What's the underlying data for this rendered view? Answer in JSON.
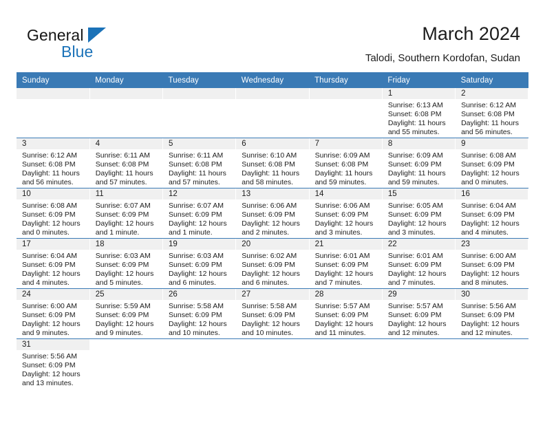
{
  "brand": {
    "name_part1": "General",
    "name_part2": "Blue",
    "color_black": "#151515",
    "color_blue": "#1b72b8"
  },
  "header": {
    "title": "March 2024",
    "location": "Talodi, Southern Kordofan, Sudan",
    "accent_color": "#3a7ab5"
  },
  "weekdays": [
    "Sunday",
    "Monday",
    "Tuesday",
    "Wednesday",
    "Thursday",
    "Friday",
    "Saturday"
  ],
  "weeks": [
    [
      {
        "day": "",
        "empty": true
      },
      {
        "day": "",
        "empty": true
      },
      {
        "day": "",
        "empty": true
      },
      {
        "day": "",
        "empty": true
      },
      {
        "day": "",
        "empty": true
      },
      {
        "day": "1",
        "sunrise": "Sunrise: 6:13 AM",
        "sunset": "Sunset: 6:08 PM",
        "daylight1": "Daylight: 11 hours",
        "daylight2": "and 55 minutes."
      },
      {
        "day": "2",
        "sunrise": "Sunrise: 6:12 AM",
        "sunset": "Sunset: 6:08 PM",
        "daylight1": "Daylight: 11 hours",
        "daylight2": "and 56 minutes."
      }
    ],
    [
      {
        "day": "3",
        "sunrise": "Sunrise: 6:12 AM",
        "sunset": "Sunset: 6:08 PM",
        "daylight1": "Daylight: 11 hours",
        "daylight2": "and 56 minutes."
      },
      {
        "day": "4",
        "sunrise": "Sunrise: 6:11 AM",
        "sunset": "Sunset: 6:08 PM",
        "daylight1": "Daylight: 11 hours",
        "daylight2": "and 57 minutes."
      },
      {
        "day": "5",
        "sunrise": "Sunrise: 6:11 AM",
        "sunset": "Sunset: 6:08 PM",
        "daylight1": "Daylight: 11 hours",
        "daylight2": "and 57 minutes."
      },
      {
        "day": "6",
        "sunrise": "Sunrise: 6:10 AM",
        "sunset": "Sunset: 6:08 PM",
        "daylight1": "Daylight: 11 hours",
        "daylight2": "and 58 minutes."
      },
      {
        "day": "7",
        "sunrise": "Sunrise: 6:09 AM",
        "sunset": "Sunset: 6:08 PM",
        "daylight1": "Daylight: 11 hours",
        "daylight2": "and 59 minutes."
      },
      {
        "day": "8",
        "sunrise": "Sunrise: 6:09 AM",
        "sunset": "Sunset: 6:09 PM",
        "daylight1": "Daylight: 11 hours",
        "daylight2": "and 59 minutes."
      },
      {
        "day": "9",
        "sunrise": "Sunrise: 6:08 AM",
        "sunset": "Sunset: 6:09 PM",
        "daylight1": "Daylight: 12 hours",
        "daylight2": "and 0 minutes."
      }
    ],
    [
      {
        "day": "10",
        "sunrise": "Sunrise: 6:08 AM",
        "sunset": "Sunset: 6:09 PM",
        "daylight1": "Daylight: 12 hours",
        "daylight2": "and 0 minutes."
      },
      {
        "day": "11",
        "sunrise": "Sunrise: 6:07 AM",
        "sunset": "Sunset: 6:09 PM",
        "daylight1": "Daylight: 12 hours",
        "daylight2": "and 1 minute."
      },
      {
        "day": "12",
        "sunrise": "Sunrise: 6:07 AM",
        "sunset": "Sunset: 6:09 PM",
        "daylight1": "Daylight: 12 hours",
        "daylight2": "and 1 minute."
      },
      {
        "day": "13",
        "sunrise": "Sunrise: 6:06 AM",
        "sunset": "Sunset: 6:09 PM",
        "daylight1": "Daylight: 12 hours",
        "daylight2": "and 2 minutes."
      },
      {
        "day": "14",
        "sunrise": "Sunrise: 6:06 AM",
        "sunset": "Sunset: 6:09 PM",
        "daylight1": "Daylight: 12 hours",
        "daylight2": "and 3 minutes."
      },
      {
        "day": "15",
        "sunrise": "Sunrise: 6:05 AM",
        "sunset": "Sunset: 6:09 PM",
        "daylight1": "Daylight: 12 hours",
        "daylight2": "and 3 minutes."
      },
      {
        "day": "16",
        "sunrise": "Sunrise: 6:04 AM",
        "sunset": "Sunset: 6:09 PM",
        "daylight1": "Daylight: 12 hours",
        "daylight2": "and 4 minutes."
      }
    ],
    [
      {
        "day": "17",
        "sunrise": "Sunrise: 6:04 AM",
        "sunset": "Sunset: 6:09 PM",
        "daylight1": "Daylight: 12 hours",
        "daylight2": "and 4 minutes."
      },
      {
        "day": "18",
        "sunrise": "Sunrise: 6:03 AM",
        "sunset": "Sunset: 6:09 PM",
        "daylight1": "Daylight: 12 hours",
        "daylight2": "and 5 minutes."
      },
      {
        "day": "19",
        "sunrise": "Sunrise: 6:03 AM",
        "sunset": "Sunset: 6:09 PM",
        "daylight1": "Daylight: 12 hours",
        "daylight2": "and 6 minutes."
      },
      {
        "day": "20",
        "sunrise": "Sunrise: 6:02 AM",
        "sunset": "Sunset: 6:09 PM",
        "daylight1": "Daylight: 12 hours",
        "daylight2": "and 6 minutes."
      },
      {
        "day": "21",
        "sunrise": "Sunrise: 6:01 AM",
        "sunset": "Sunset: 6:09 PM",
        "daylight1": "Daylight: 12 hours",
        "daylight2": "and 7 minutes."
      },
      {
        "day": "22",
        "sunrise": "Sunrise: 6:01 AM",
        "sunset": "Sunset: 6:09 PM",
        "daylight1": "Daylight: 12 hours",
        "daylight2": "and 7 minutes."
      },
      {
        "day": "23",
        "sunrise": "Sunrise: 6:00 AM",
        "sunset": "Sunset: 6:09 PM",
        "daylight1": "Daylight: 12 hours",
        "daylight2": "and 8 minutes."
      }
    ],
    [
      {
        "day": "24",
        "sunrise": "Sunrise: 6:00 AM",
        "sunset": "Sunset: 6:09 PM",
        "daylight1": "Daylight: 12 hours",
        "daylight2": "and 9 minutes."
      },
      {
        "day": "25",
        "sunrise": "Sunrise: 5:59 AM",
        "sunset": "Sunset: 6:09 PM",
        "daylight1": "Daylight: 12 hours",
        "daylight2": "and 9 minutes."
      },
      {
        "day": "26",
        "sunrise": "Sunrise: 5:58 AM",
        "sunset": "Sunset: 6:09 PM",
        "daylight1": "Daylight: 12 hours",
        "daylight2": "and 10 minutes."
      },
      {
        "day": "27",
        "sunrise": "Sunrise: 5:58 AM",
        "sunset": "Sunset: 6:09 PM",
        "daylight1": "Daylight: 12 hours",
        "daylight2": "and 10 minutes."
      },
      {
        "day": "28",
        "sunrise": "Sunrise: 5:57 AM",
        "sunset": "Sunset: 6:09 PM",
        "daylight1": "Daylight: 12 hours",
        "daylight2": "and 11 minutes."
      },
      {
        "day": "29",
        "sunrise": "Sunrise: 5:57 AM",
        "sunset": "Sunset: 6:09 PM",
        "daylight1": "Daylight: 12 hours",
        "daylight2": "and 12 minutes."
      },
      {
        "day": "30",
        "sunrise": "Sunrise: 5:56 AM",
        "sunset": "Sunset: 6:09 PM",
        "daylight1": "Daylight: 12 hours",
        "daylight2": "and 12 minutes."
      }
    ],
    [
      {
        "day": "31",
        "sunrise": "Sunrise: 5:56 AM",
        "sunset": "Sunset: 6:09 PM",
        "daylight1": "Daylight: 12 hours",
        "daylight2": "and 13 minutes."
      },
      {
        "day": "",
        "blank": true
      },
      {
        "day": "",
        "blank": true
      },
      {
        "day": "",
        "blank": true
      },
      {
        "day": "",
        "blank": true
      },
      {
        "day": "",
        "blank": true
      },
      {
        "day": "",
        "blank": true
      }
    ]
  ]
}
